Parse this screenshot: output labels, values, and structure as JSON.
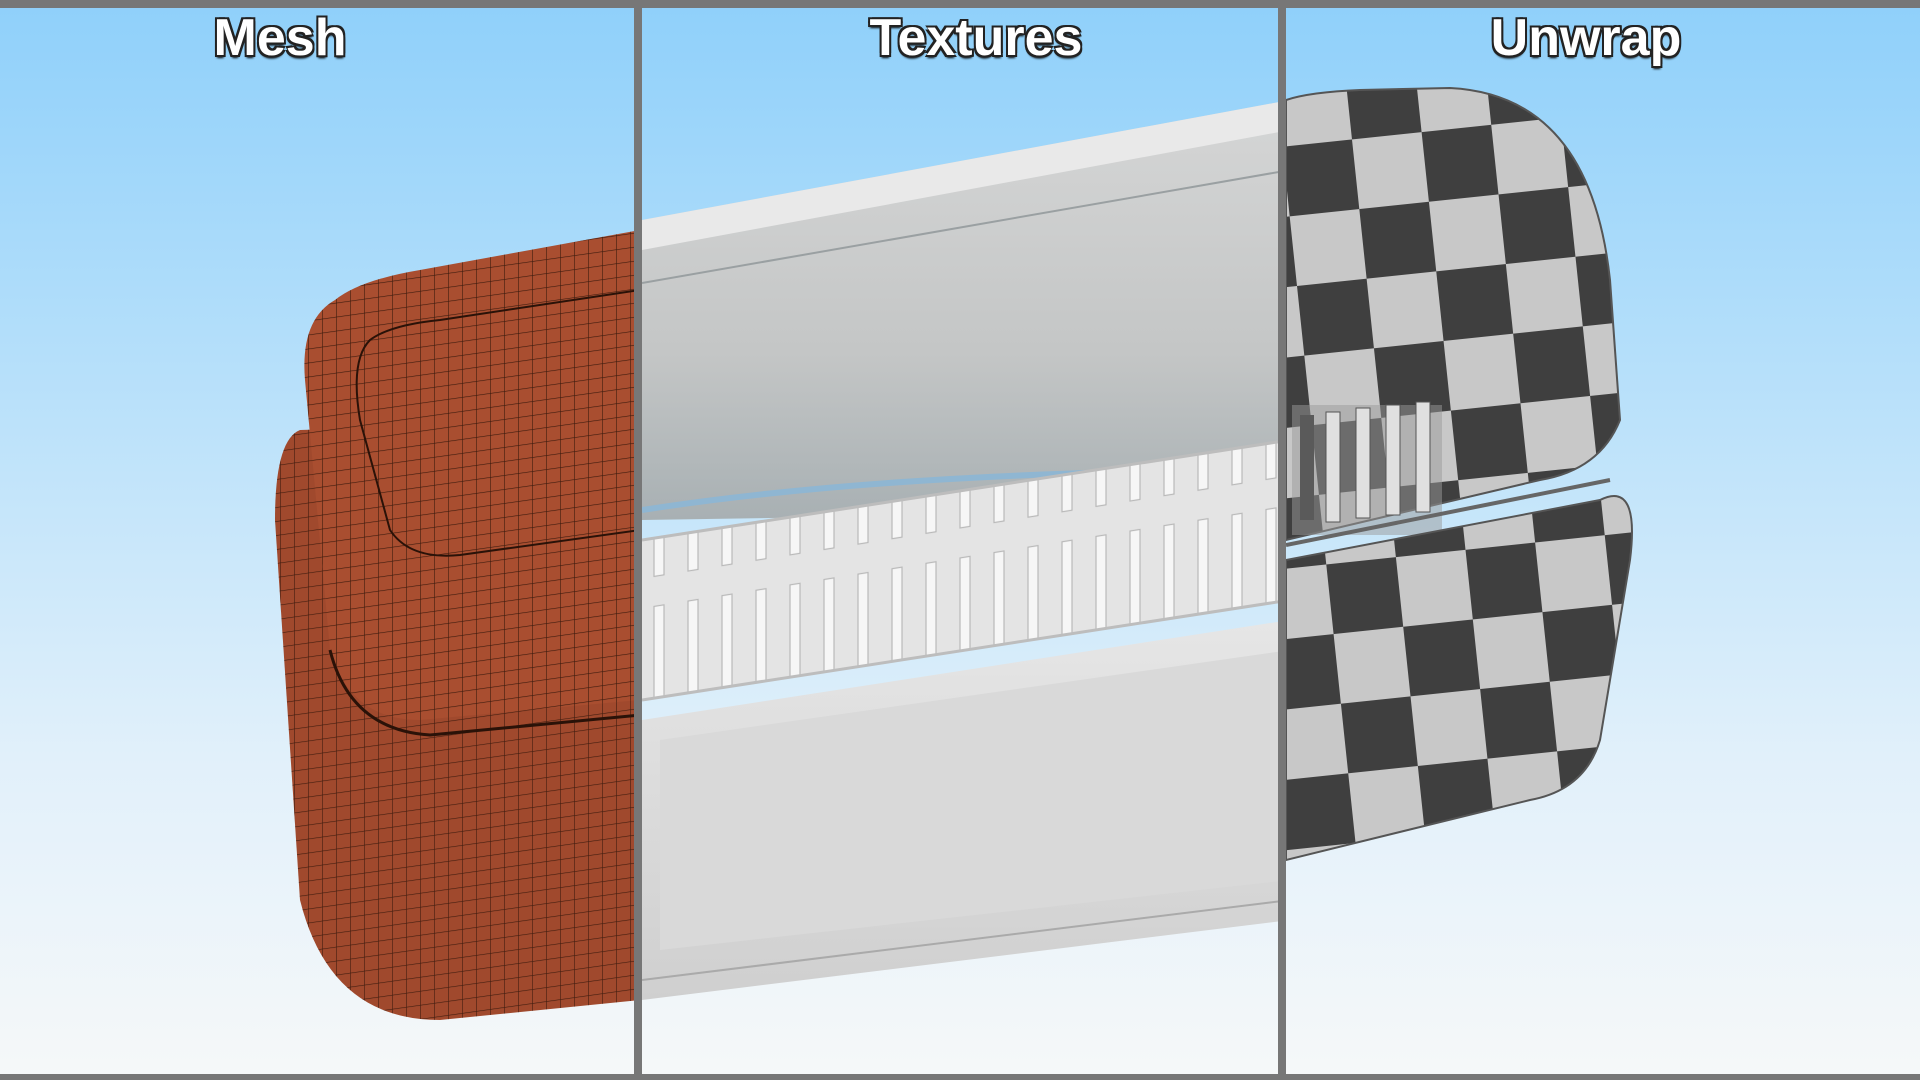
{
  "panels": [
    {
      "title": "Mesh"
    },
    {
      "title": "Textures"
    },
    {
      "title": "Unwrap"
    }
  ],
  "colors": {
    "sky_top": "#8fd0fa",
    "sky_bottom": "#f6f8f9",
    "mesh_fill": "#a0492d",
    "mesh_wire": "#2a1208",
    "texture_silver": "#d8d8d8",
    "checker_dark": "#3f3f3f",
    "checker_light": "#c8c8c8",
    "divider": "#777777"
  }
}
